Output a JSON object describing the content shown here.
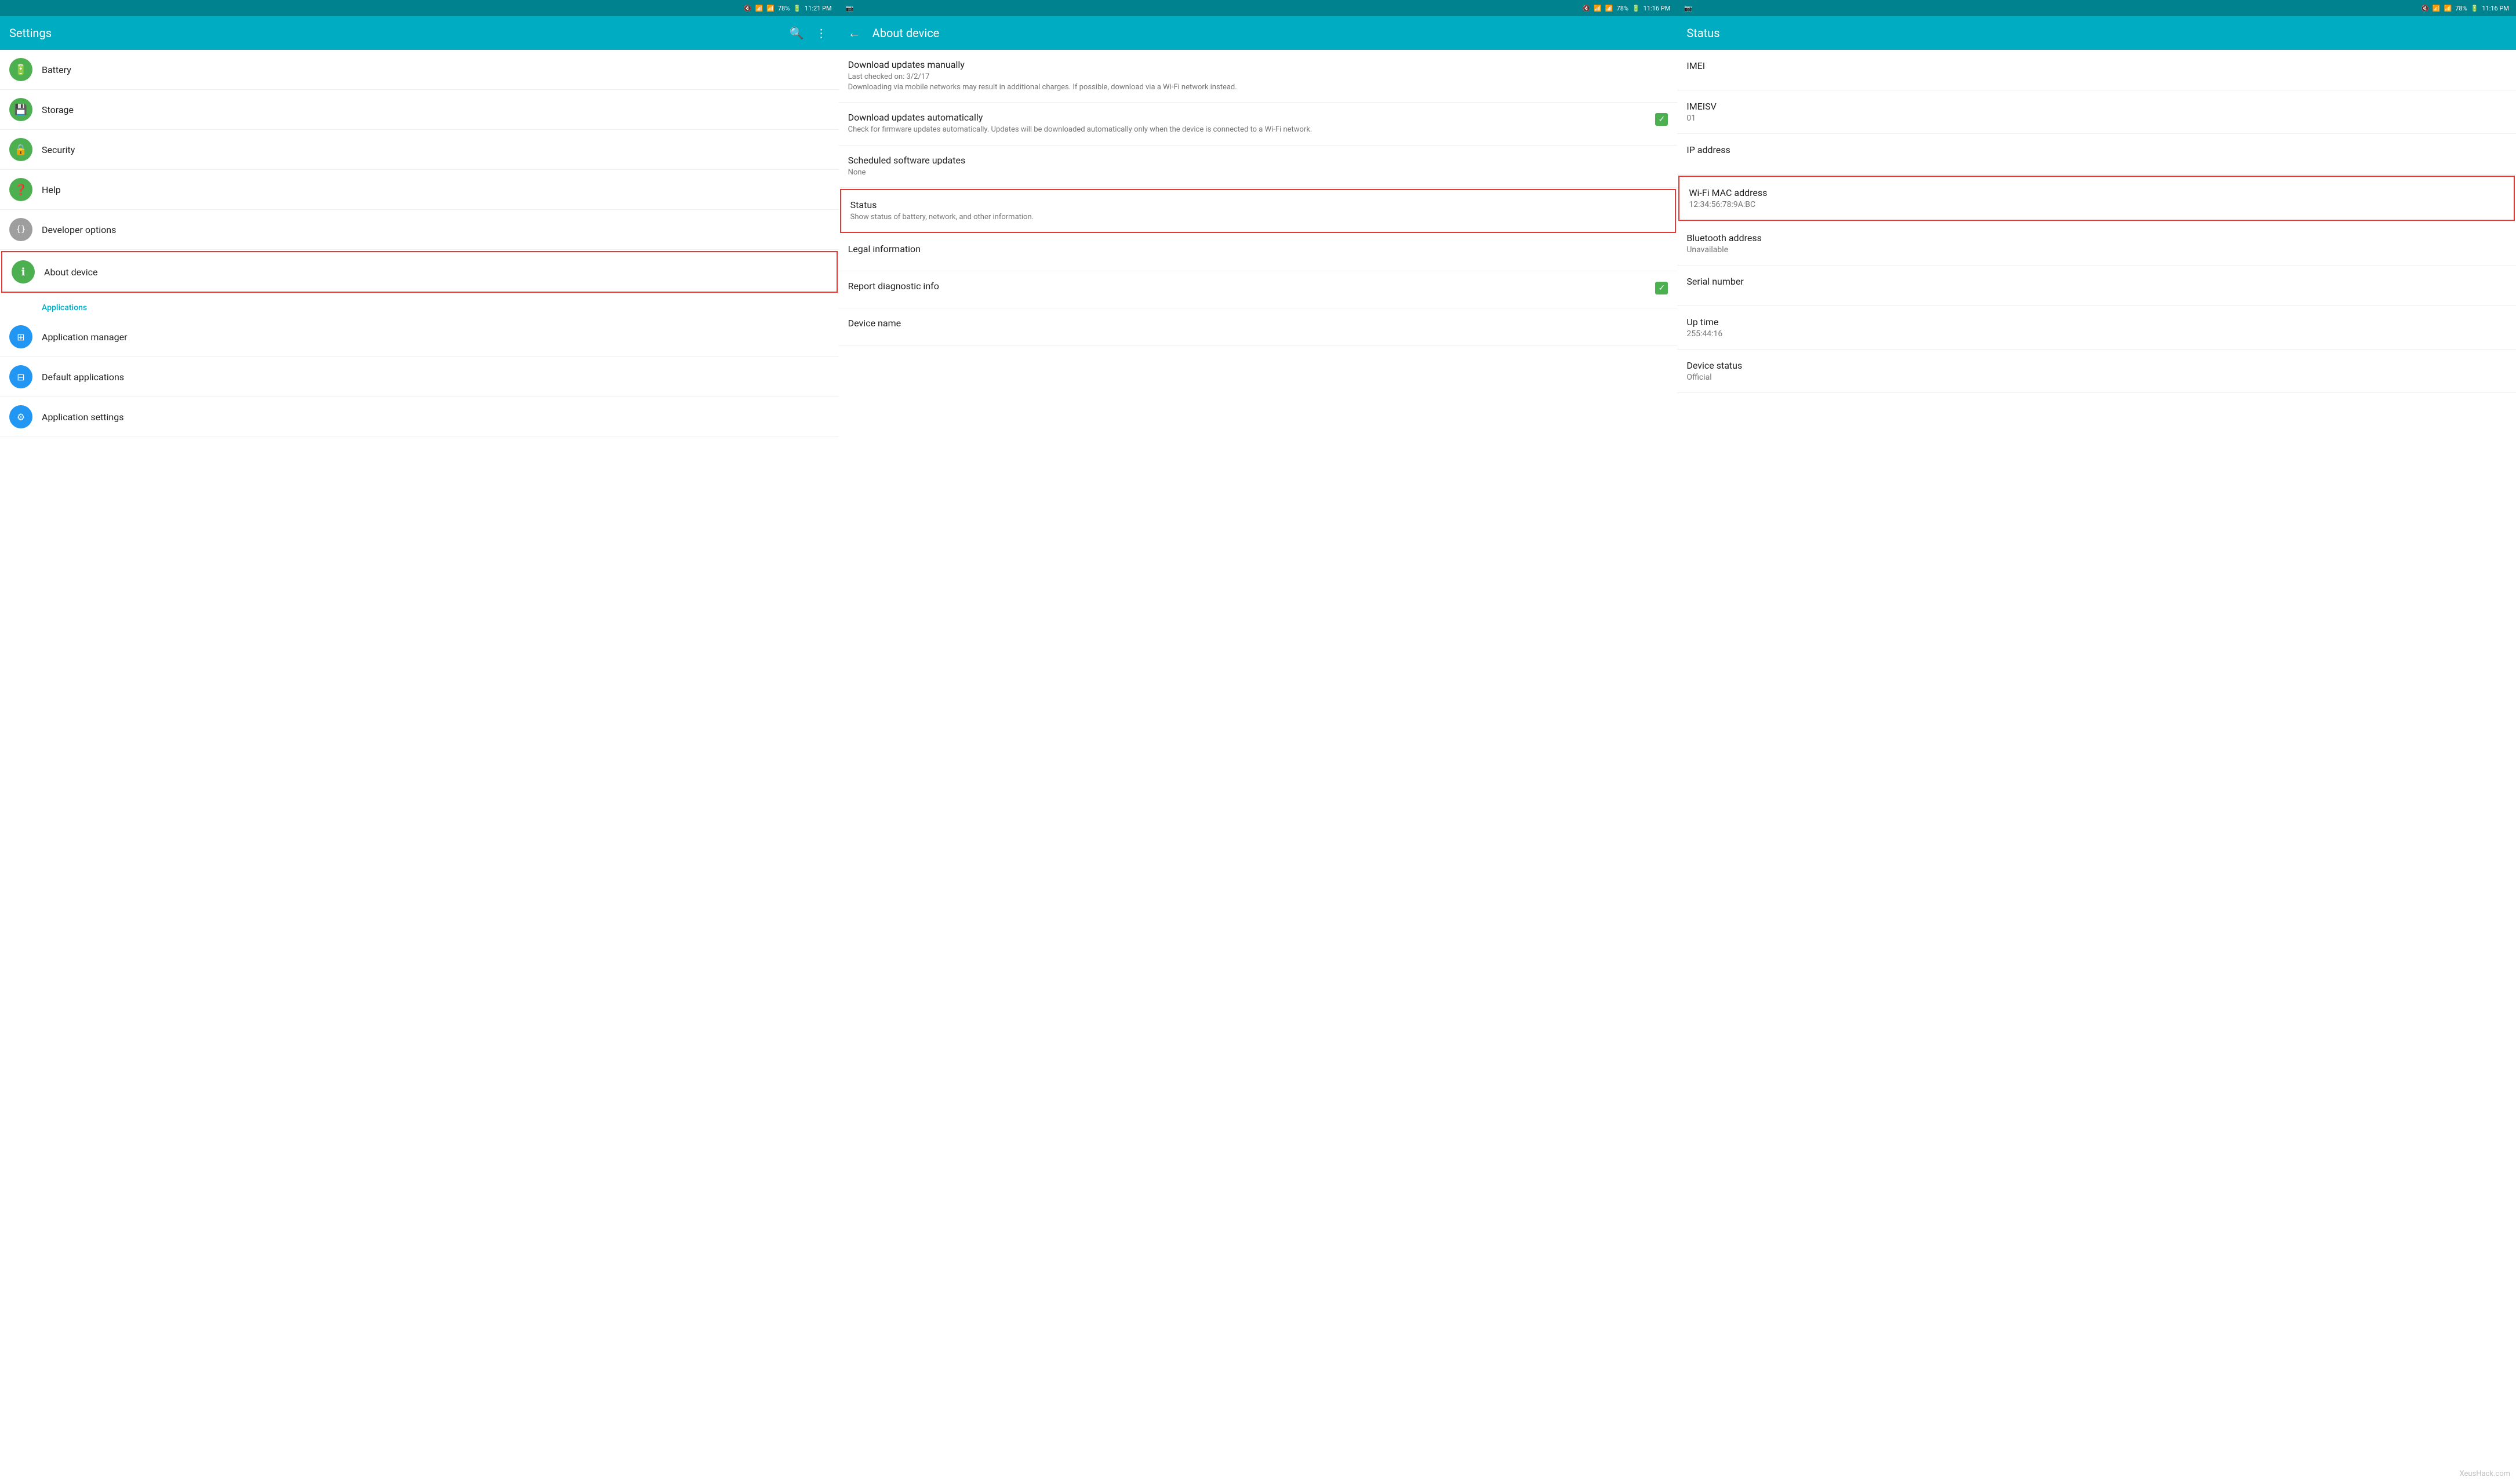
{
  "panel1": {
    "statusBar": {
      "time": "11:21 PM",
      "battery": "78%",
      "signal": "▲▼"
    },
    "appBar": {
      "title": "Settings",
      "searchIcon": "🔍",
      "moreIcon": "⋮"
    },
    "items": [
      {
        "id": "battery",
        "icon": "🔋",
        "iconColor": "icon-green",
        "title": "Battery",
        "subtitle": ""
      },
      {
        "id": "storage",
        "icon": "💾",
        "iconColor": "icon-green",
        "title": "Storage",
        "subtitle": ""
      },
      {
        "id": "security",
        "icon": "🔒",
        "iconColor": "icon-green",
        "title": "Security",
        "subtitle": ""
      },
      {
        "id": "help",
        "icon": "❓",
        "iconColor": "icon-green",
        "title": "Help",
        "subtitle": ""
      },
      {
        "id": "developer",
        "icon": "{}",
        "iconColor": "icon-gray",
        "title": "Developer options",
        "subtitle": ""
      },
      {
        "id": "about",
        "icon": "ℹ",
        "iconColor": "icon-green",
        "title": "About device",
        "subtitle": "",
        "selected": true
      }
    ],
    "sectionHeader": "Applications",
    "appItems": [
      {
        "id": "app-manager",
        "icon": "⊞",
        "iconColor": "icon-blue",
        "title": "Application manager",
        "subtitle": ""
      },
      {
        "id": "default-apps",
        "icon": "⊟",
        "iconColor": "icon-blue",
        "title": "Default applications",
        "subtitle": ""
      },
      {
        "id": "app-settings",
        "icon": "⚙",
        "iconColor": "icon-blue",
        "title": "Application settings",
        "subtitle": ""
      }
    ]
  },
  "panel2": {
    "statusBar": {
      "time": "11:16 PM",
      "battery": "78%"
    },
    "appBar": {
      "backLabel": "←",
      "title": "About device"
    },
    "items": [
      {
        "id": "download-manual",
        "title": "Download updates manually",
        "subtitle": "Last checked on: 3/2/17\nDownloading via mobile networks may result in additional charges. If possible, download via a Wi-Fi network instead.",
        "hasCheckbox": false
      },
      {
        "id": "download-auto",
        "title": "Download updates automatically",
        "subtitle": "Check for firmware updates automatically. Updates will be downloaded automatically only when the device is connected to a Wi-Fi network.",
        "hasCheckbox": true,
        "checked": true
      },
      {
        "id": "scheduled-updates",
        "title": "Scheduled software updates",
        "subtitle": "None",
        "hasCheckbox": false
      },
      {
        "id": "status",
        "title": "Status",
        "subtitle": "Show status of battery, network, and other information.",
        "hasCheckbox": false,
        "selected": true
      },
      {
        "id": "legal",
        "title": "Legal information",
        "subtitle": "",
        "hasCheckbox": false
      },
      {
        "id": "diagnostic",
        "title": "Report diagnostic info",
        "subtitle": "",
        "hasCheckbox": true,
        "checked": true
      },
      {
        "id": "device-name",
        "title": "Device name",
        "subtitle": "",
        "hasCheckbox": false
      }
    ]
  },
  "panel3": {
    "statusBar": {
      "time": "11:16 PM",
      "battery": "78%"
    },
    "appBar": {
      "title": "Status"
    },
    "items": [
      {
        "id": "imei",
        "title": "IMEI",
        "value": "",
        "selected": false
      },
      {
        "id": "imeisv",
        "title": "IMEISV",
        "value": "01",
        "selected": false
      },
      {
        "id": "ip-address",
        "title": "IP address",
        "value": "",
        "selected": false
      },
      {
        "id": "wifi-mac",
        "title": "Wi-Fi MAC address",
        "value": "12:34:56:78:9A:BC",
        "selected": true
      },
      {
        "id": "bluetooth",
        "title": "Bluetooth address",
        "value": "Unavailable",
        "selected": false
      },
      {
        "id": "serial",
        "title": "Serial number",
        "value": "",
        "selected": false
      },
      {
        "id": "uptime",
        "title": "Up time",
        "value": "255:44:16",
        "selected": false
      },
      {
        "id": "device-status",
        "title": "Device status",
        "value": "Official",
        "selected": false
      }
    ],
    "watermark": "XeusHack.com"
  }
}
